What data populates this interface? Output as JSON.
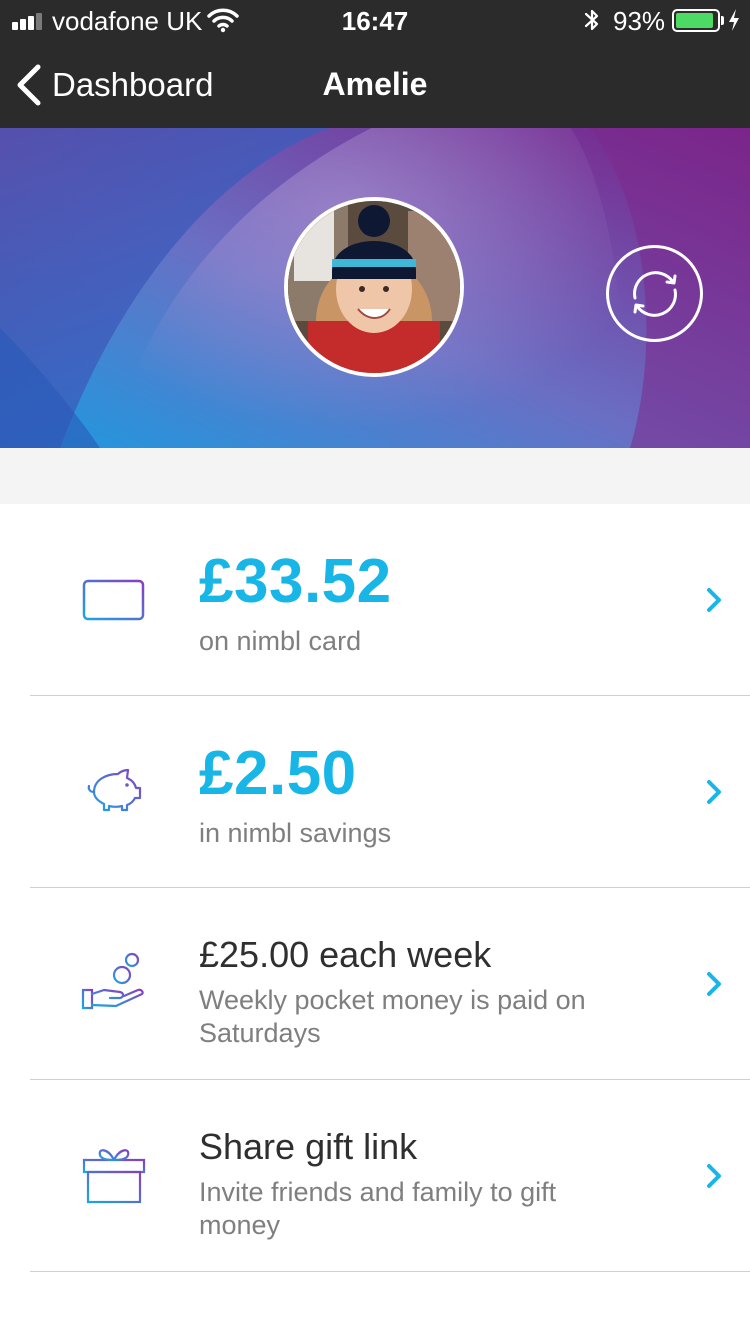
{
  "status_bar": {
    "carrier": "vodafone UK",
    "time": "16:47",
    "battery_percent": "93%",
    "battery_level": 0.93
  },
  "nav": {
    "back_label": "Dashboard",
    "title": "Amelie"
  },
  "colors": {
    "accent": "#17b6e6",
    "header_bg": "#2b2b2b",
    "hero_purple": "#7a1f86",
    "hero_blue": "#1b9be0",
    "icon_gradient_start": "#1ba6e6",
    "icon_gradient_end": "#8a3dbf"
  },
  "accounts": [
    {
      "icon": "card-icon",
      "amount": "£33.52",
      "label": "on nimbl card"
    },
    {
      "icon": "piggy-bank-icon",
      "amount": "£2.50",
      "label": "in nimbl savings"
    }
  ],
  "pocket_money": {
    "icon": "hand-coins-icon",
    "title": "£25.00 each week",
    "description": "Weekly pocket money is paid on Saturdays"
  },
  "gift": {
    "icon": "gift-icon",
    "title": "Share gift link",
    "description": "Invite friends and family to gift money"
  },
  "icons": {
    "back": "chevron-left-icon",
    "switch_child": "refresh-icon",
    "row_chevron": "chevron-right-icon"
  }
}
